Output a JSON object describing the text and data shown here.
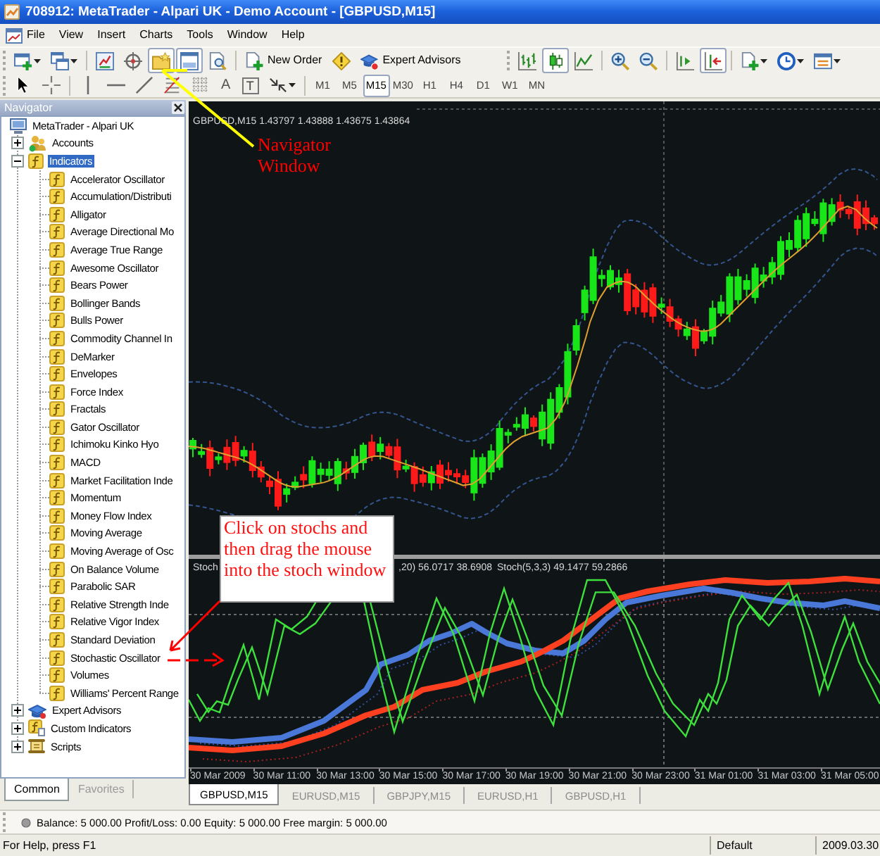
{
  "window": {
    "title": "708912: MetaTrader - Alpari UK - Demo Account - [GBPUSD,M15]"
  },
  "menu": [
    "File",
    "View",
    "Insert",
    "Charts",
    "Tools",
    "Window",
    "Help"
  ],
  "main_toolbar": [
    [
      {
        "dropdown": true,
        "pressed": false
      },
      {
        "dropdown": true,
        "pressed": false
      }
    ],
    [
      {
        "pressed": false
      },
      {
        "pressed": false
      },
      {
        "pressed": true
      },
      {
        "pressed": true
      },
      {
        "pressed": false
      }
    ],
    [
      {
        "label": "New Order",
        "pressed": false
      },
      {
        "pressed": false
      },
      {
        "label": "Expert Advisors",
        "pressed": false
      }
    ]
  ],
  "chart_toolbar": [
    [
      {
        "pressed": false
      },
      {
        "pressed": true
      },
      {
        "pressed": false
      }
    ],
    [
      {
        "pressed": false
      },
      {
        "pressed": false
      }
    ],
    [
      {
        "pressed": false
      },
      {
        "pressed": true
      }
    ],
    [
      {
        "dropdown": true,
        "pressed": false
      },
      {
        "dropdown": true,
        "pressed": false
      },
      {
        "dropdown": true,
        "pressed": false
      }
    ]
  ],
  "drawing_toolbar": [
    [
      {
        "pressed": false
      },
      {
        "pressed": false
      }
    ],
    [
      {
        "pressed": false
      },
      {
        "pressed": false
      },
      {
        "pressed": false
      },
      {
        "pressed": false
      },
      {
        "pressed": false
      },
      {
        "kind": "glyph",
        "glyph": "A",
        "pressed": false
      },
      {
        "kind": "framed_glyph",
        "glyph": "T",
        "pressed": false
      },
      {
        "dropdown": true,
        "pressed": false
      }
    ]
  ],
  "timeframes": [
    {
      "label": "M1",
      "selected": false
    },
    {
      "label": "M5",
      "selected": false
    },
    {
      "label": "M15",
      "selected": true
    },
    {
      "label": "M30",
      "selected": false
    },
    {
      "label": "H1",
      "selected": false
    },
    {
      "label": "H4",
      "selected": false
    },
    {
      "label": "D1",
      "selected": false
    },
    {
      "label": "W1",
      "selected": false
    },
    {
      "label": "MN",
      "selected": false
    }
  ],
  "navigator": {
    "title": "Navigator",
    "tree": [
      {
        "label": "MetaTrader - Alpari UK",
        "kind": "terminal",
        "selected": false,
        "children": [
          {
            "label": "Accounts",
            "kind": "accounts",
            "expanded": false,
            "selected": false
          },
          {
            "label": "Indicators",
            "kind": "indicator",
            "expanded": true,
            "selected": true,
            "children": [
              {
                "label": "Accelerator Oscillator",
                "kind": "indicator",
                "selected": false
              },
              {
                "label": "Accumulation/Distributi",
                "kind": "indicator",
                "selected": false
              },
              {
                "label": "Alligator",
                "kind": "indicator",
                "selected": false
              },
              {
                "label": "Average Directional Mo",
                "kind": "indicator",
                "selected": false
              },
              {
                "label": "Average True Range",
                "kind": "indicator",
                "selected": false
              },
              {
                "label": "Awesome Oscillator",
                "kind": "indicator",
                "selected": false
              },
              {
                "label": "Bears Power",
                "kind": "indicator",
                "selected": false
              },
              {
                "label": "Bollinger Bands",
                "kind": "indicator",
                "selected": false
              },
              {
                "label": "Bulls Power",
                "kind": "indicator",
                "selected": false
              },
              {
                "label": "Commodity Channel In",
                "kind": "indicator",
                "selected": false
              },
              {
                "label": "DeMarker",
                "kind": "indicator",
                "selected": false
              },
              {
                "label": "Envelopes",
                "kind": "indicator",
                "selected": false
              },
              {
                "label": "Force Index",
                "kind": "indicator",
                "selected": false
              },
              {
                "label": "Fractals",
                "kind": "indicator",
                "selected": false
              },
              {
                "label": "Gator Oscillator",
                "kind": "indicator",
                "selected": false
              },
              {
                "label": "Ichimoku Kinko Hyo",
                "kind": "indicator",
                "selected": false
              },
              {
                "label": "MACD",
                "kind": "indicator",
                "selected": false
              },
              {
                "label": "Market Facilitation Inde",
                "kind": "indicator",
                "selected": false
              },
              {
                "label": "Momentum",
                "kind": "indicator",
                "selected": false
              },
              {
                "label": "Money Flow Index",
                "kind": "indicator",
                "selected": false
              },
              {
                "label": "Moving Average",
                "kind": "indicator",
                "selected": false
              },
              {
                "label": "Moving Average of Osc",
                "kind": "indicator",
                "selected": false
              },
              {
                "label": "On Balance Volume",
                "kind": "indicator",
                "selected": false
              },
              {
                "label": "Parabolic SAR",
                "kind": "indicator",
                "selected": false
              },
              {
                "label": "Relative Strength Inde",
                "kind": "indicator",
                "selected": false
              },
              {
                "label": "Relative Vigor Index",
                "kind": "indicator",
                "selected": false
              },
              {
                "label": "Standard Deviation",
                "kind": "indicator",
                "selected": false
              },
              {
                "label": "Stochastic Oscillator",
                "kind": "indicator",
                "selected": false
              },
              {
                "label": "Volumes",
                "kind": "indicator",
                "selected": false
              },
              {
                "label": "Williams' Percent Range",
                "kind": "indicator",
                "selected": false
              }
            ]
          },
          {
            "label": "Expert Advisors",
            "kind": "experts",
            "expanded": false,
            "selected": false
          },
          {
            "label": "Custom Indicators",
            "kind": "custom",
            "expanded": false,
            "selected": false
          },
          {
            "label": "Scripts",
            "kind": "scripts",
            "expanded": false,
            "selected": false
          }
        ]
      }
    ],
    "tabs": [
      {
        "label": "Common",
        "selected": true
      },
      {
        "label": "Favorites",
        "selected": false
      }
    ]
  },
  "chart": {
    "header": "GBPUSD,M15 1.43797 1.43888 1.43675 1.43864",
    "indicator_labels": [
      "Stoch",
      ",20) 56.0717 38.6908",
      "Stoch(5,3,3) 49.1477 59.2866"
    ],
    "time_axis": [
      "30 Mar 2009",
      "30 Mar 11:00",
      "30 Mar 13:00",
      "30 Mar 15:00",
      "30 Mar 17:00",
      "30 Mar 19:00",
      "30 Mar 21:00",
      "30 Mar 23:00",
      "31 Mar 01:00",
      "31 Mar 03:00",
      "31 Mar 05:00"
    ],
    "tabs": [
      {
        "label": "GBPUSD,M15",
        "selected": true
      },
      {
        "label": "EURUSD,M15",
        "selected": false
      },
      {
        "label": "GBPJPY,M15",
        "selected": false
      },
      {
        "label": "EURUSD,H1",
        "selected": false
      },
      {
        "label": "GBPUSD,H1",
        "selected": false
      }
    ]
  },
  "annotations": [
    {
      "kind": "label",
      "text": "Navigator Window"
    },
    {
      "kind": "note",
      "text": "Click on stochs and then drag the mouse into the stoch window"
    }
  ],
  "account_summary": "Balance: 5 000.00 Profit/Loss: 0.00 Equity: 5 000.00 Free margin: 5 000.00",
  "status_bar": {
    "help": "For Help, press F1",
    "profile": "Default",
    "date": "2009.03.30"
  }
}
